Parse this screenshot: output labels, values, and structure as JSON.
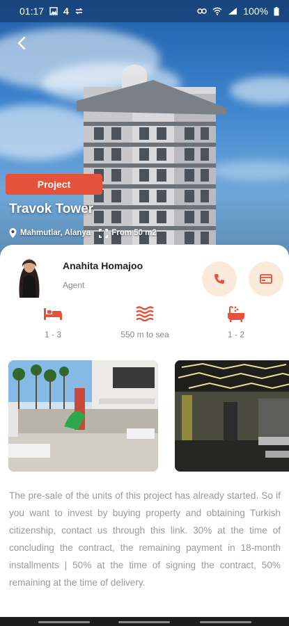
{
  "status_bar": {
    "time": "01:17",
    "network": "4",
    "battery": "100%"
  },
  "project": {
    "badge": "Project",
    "title": "Travok Tower",
    "location": "Mahmutlar, Alanya",
    "area": "From 50 m2"
  },
  "agent": {
    "name": "Anahita Homajoo",
    "role": "Agent"
  },
  "features": [
    {
      "icon": "bed-icon",
      "label": "1 - 3"
    },
    {
      "icon": "sea-waves-icon",
      "label": "550 m to sea"
    },
    {
      "icon": "bathtub-icon",
      "label": "1 - 2"
    }
  ],
  "description": "The pre-sale of the units of this project has already started. So if you want to invest by buying property and obtaining Turkish citizenship, contact us through this link. 30% at the time of concluding the contract, the remaining payment in 18-month installments | 50% at the time of signing the contract, 50% remaining at the time of delivery.",
  "colors": {
    "accent": "#e4523b",
    "accent_soft": "#fbe9da"
  }
}
